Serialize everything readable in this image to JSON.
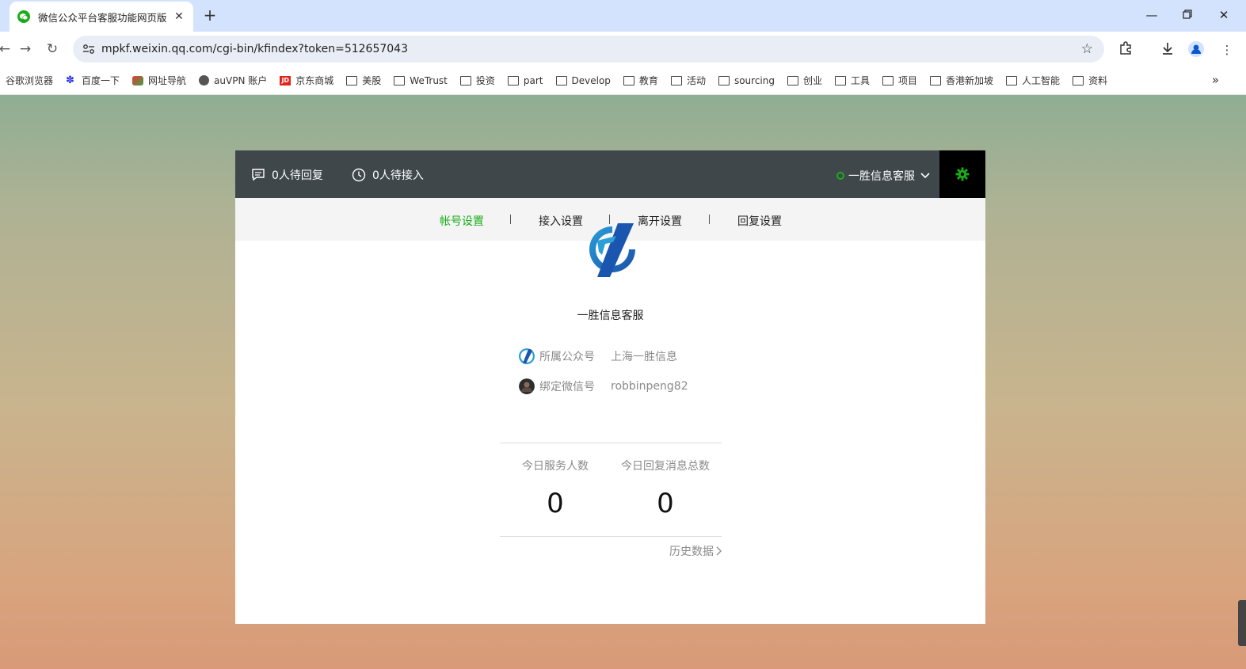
{
  "browser": {
    "tab_title": "微信公众平台客服功能网页版",
    "url": "mpkf.weixin.qq.com/cgi-bin/kfindex?token=512657043",
    "bookmarks": [
      {
        "label": "谷歌浏览器",
        "icon": "none"
      },
      {
        "label": "百度一下",
        "icon": "baidu-icon"
      },
      {
        "label": "网址导航",
        "icon": "nav-icon"
      },
      {
        "label": "auVPN 账户",
        "icon": "globe-icon"
      },
      {
        "label": "京东商城",
        "icon": "jd-icon"
      },
      {
        "label": "美股",
        "icon": "folder-icon"
      },
      {
        "label": "WeTrust",
        "icon": "folder-icon"
      },
      {
        "label": "投资",
        "icon": "folder-icon"
      },
      {
        "label": "part",
        "icon": "folder-icon"
      },
      {
        "label": "Develop",
        "icon": "folder-icon"
      },
      {
        "label": "教育",
        "icon": "folder-icon"
      },
      {
        "label": "活动",
        "icon": "folder-icon"
      },
      {
        "label": "sourcing",
        "icon": "folder-icon"
      },
      {
        "label": "创业",
        "icon": "folder-icon"
      },
      {
        "label": "工具",
        "icon": "folder-icon"
      },
      {
        "label": "项目",
        "icon": "folder-icon"
      },
      {
        "label": "香港新加坡",
        "icon": "folder-icon"
      },
      {
        "label": "人工智能",
        "icon": "folder-icon"
      },
      {
        "label": "资料",
        "icon": "folder-icon"
      }
    ]
  },
  "topbar": {
    "pending_reply": "0人待回复",
    "pending_access": "0人待接入",
    "agent_name": "一胜信息客服",
    "status_color": "#1aad19"
  },
  "subnav": {
    "items": [
      "帐号设置",
      "接入设置",
      "离开设置",
      "回复设置"
    ],
    "active": "帐号设置"
  },
  "account": {
    "name": "一胜信息客服",
    "official_label": "所属公众号",
    "official_value": "上海一胜信息",
    "wechat_label": "绑定微信号",
    "wechat_value": "robbinpeng82"
  },
  "stats": {
    "served_label": "今日服务人数",
    "served_value": "0",
    "messages_label": "今日回复消息总数",
    "messages_value": "0",
    "history_link": "历史数据"
  },
  "colors": {
    "accent": "#1aad19",
    "topbar_bg": "#3f474b"
  }
}
